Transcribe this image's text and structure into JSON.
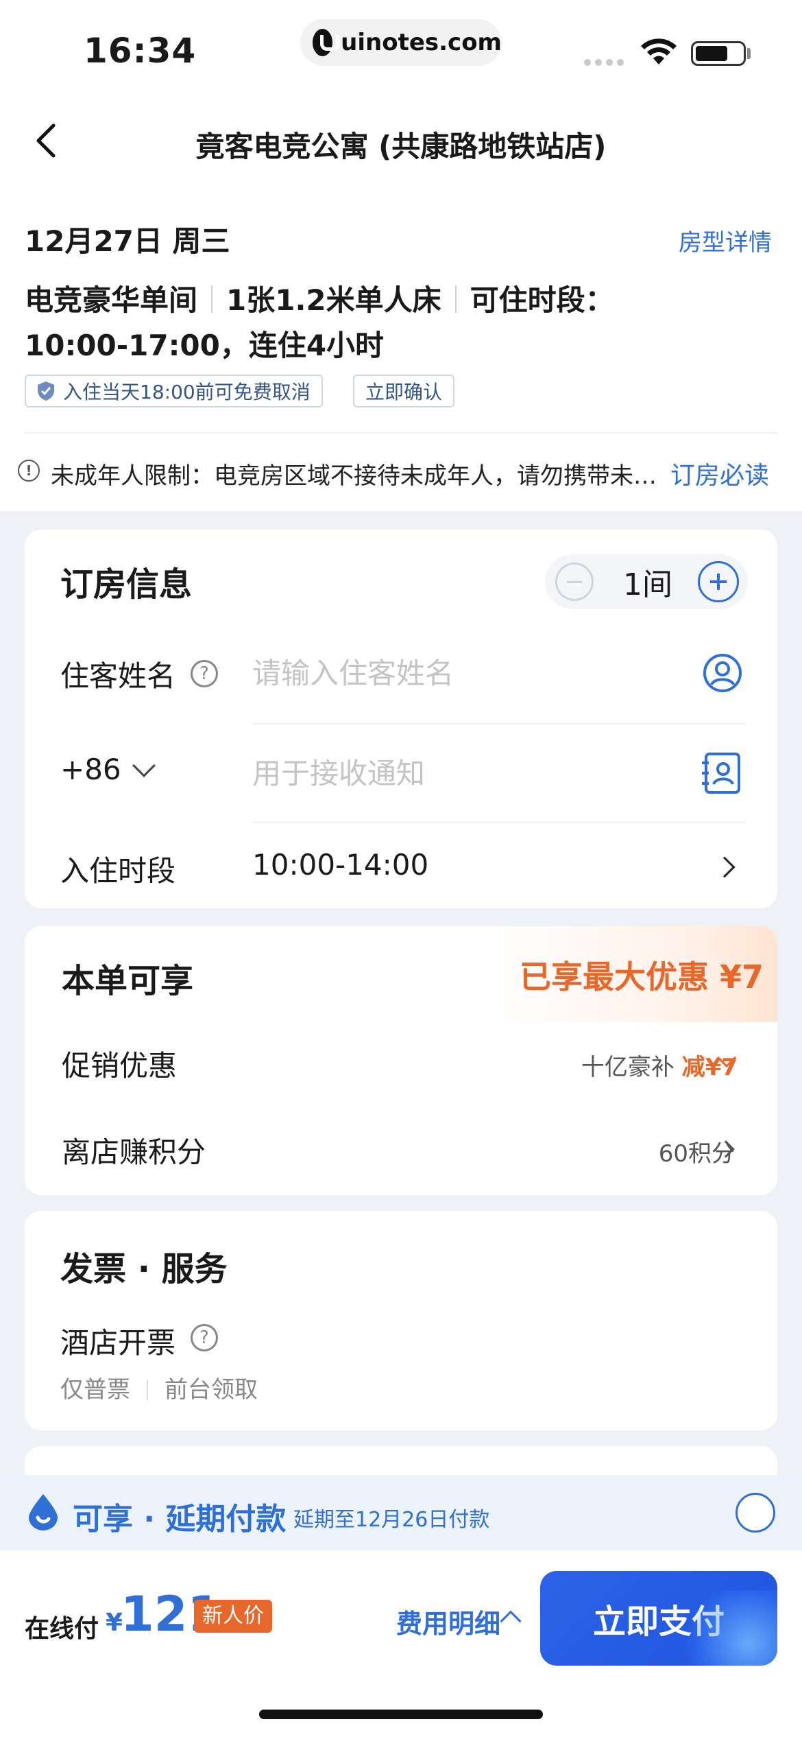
{
  "status_bar": {
    "time": "16:34",
    "url": "uinotes.com"
  },
  "nav": {
    "title": "竟客电竞公寓 (共康路地铁站店)"
  },
  "room": {
    "date": "12月27日 周三",
    "detail_link": "房型详情",
    "type": "电竞豪华单间",
    "bed": "1张1.2米单人床",
    "period_label": "可住时段：",
    "period_value": "10:00-17:00，连住4小时",
    "tags": [
      "入住当天18:00前可免费取消",
      "立即确认"
    ],
    "notice_text": "未成年人限制：电竞房区域不接待未成年人，请勿携带未成年人入住",
    "notice_link": "订房必读"
  },
  "booking": {
    "title": "订房信息",
    "room_count": "1间",
    "guest_label": "住客姓名",
    "guest_placeholder": "请输入住客姓名",
    "phone_prefix": "+86",
    "phone_placeholder": "用于接收通知",
    "checkin_label": "入住时段",
    "checkin_value": "10:00-14:00"
  },
  "discount": {
    "title": "本单可享",
    "max_discount": "已享最大优惠 ¥7",
    "promo_label": "促销优惠",
    "promo_name": "十亿豪补",
    "promo_amount": "减¥7",
    "points_label": "离店赚积分",
    "points_value": "60积分"
  },
  "invoice": {
    "title": "发票 · 服务",
    "hotel_invoice_label": "酒店开票",
    "option_1": "仅普票",
    "option_2": "前台领取"
  },
  "deferred": {
    "title": "可享 · 延期付款",
    "subtitle": "延期至12月26日付款"
  },
  "pay": {
    "label": "在线付",
    "currency": "¥",
    "amount": "121",
    "badge": "新人价",
    "fee_link": "费用明细",
    "button": "立即支付"
  },
  "colors": {
    "accent": "#2f6fd6",
    "pay_button": "#2c63e8",
    "discount": "#e8682b"
  }
}
